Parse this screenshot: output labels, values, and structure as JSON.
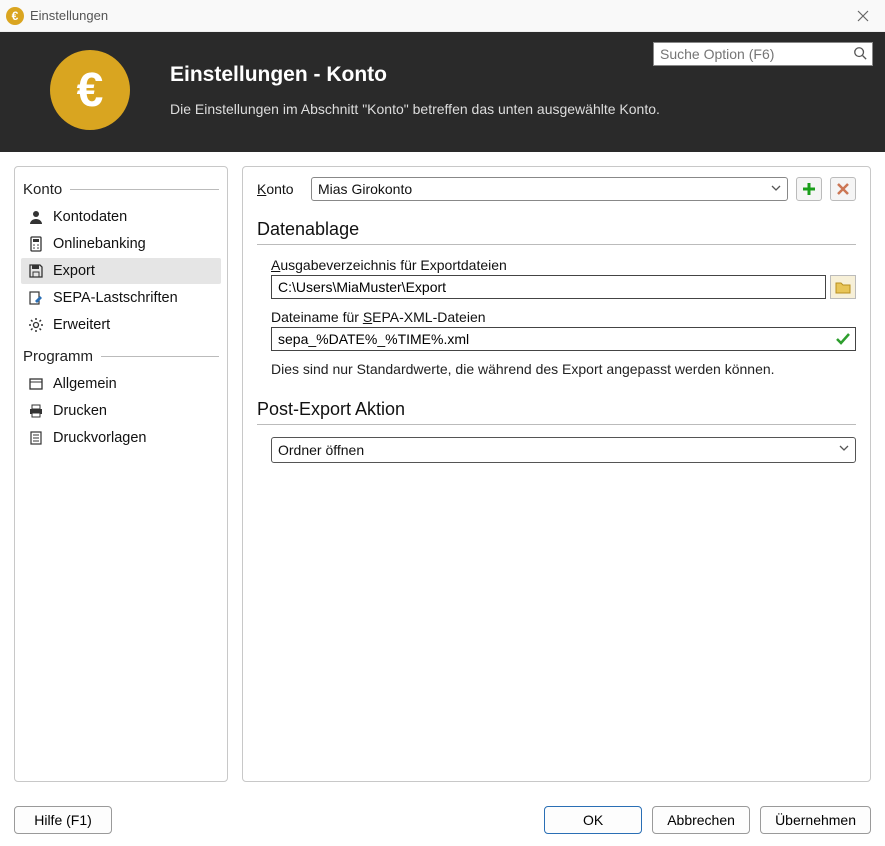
{
  "window": {
    "title": "Einstellungen"
  },
  "header": {
    "title": "Einstellungen - Konto",
    "subtitle": "Die Einstellungen im Abschnitt \"Konto\" betreffen das unten ausgewählte Konto.",
    "search_placeholder": "Suche Option (F6)"
  },
  "sidebar": {
    "groups": [
      {
        "label": "Konto",
        "items": [
          {
            "icon": "user-icon",
            "label": "Kontodaten"
          },
          {
            "icon": "calculator-icon",
            "label": "Onlinebanking"
          },
          {
            "icon": "save-icon",
            "label": "Export",
            "selected": true
          },
          {
            "icon": "document-edit-icon",
            "label": "SEPA-Lastschriften"
          },
          {
            "icon": "gear-icon",
            "label": "Erweitert"
          }
        ]
      },
      {
        "label": "Programm",
        "items": [
          {
            "icon": "window-icon",
            "label": "Allgemein"
          },
          {
            "icon": "printer-icon",
            "label": "Drucken"
          },
          {
            "icon": "template-icon",
            "label": "Druckvorlagen"
          }
        ]
      }
    ]
  },
  "main": {
    "konto_label": "Konto",
    "konto_value": "Mias Girokonto",
    "section1_title": "Datenablage",
    "field1_label_pre": "A",
    "field1_label_rest": "usgabeverzeichnis für Exportdateien",
    "field1_value": "C:\\Users\\MiaMuster\\Export",
    "field2_label_pre": "Dateiname für ",
    "field2_label_ul": "S",
    "field2_label_rest": "EPA-XML-Dateien",
    "field2_value": "sepa_%DATE%_%TIME%.xml",
    "hint": "Dies sind nur Standardwerte, die während des Export angepasst werden können.",
    "section2_title": "Post-Export Aktion",
    "action_value": "Ordner öffnen"
  },
  "footer": {
    "help": "Hilfe (F1)",
    "ok": "OK",
    "cancel": "Abbrechen",
    "apply": "Übernehmen"
  }
}
